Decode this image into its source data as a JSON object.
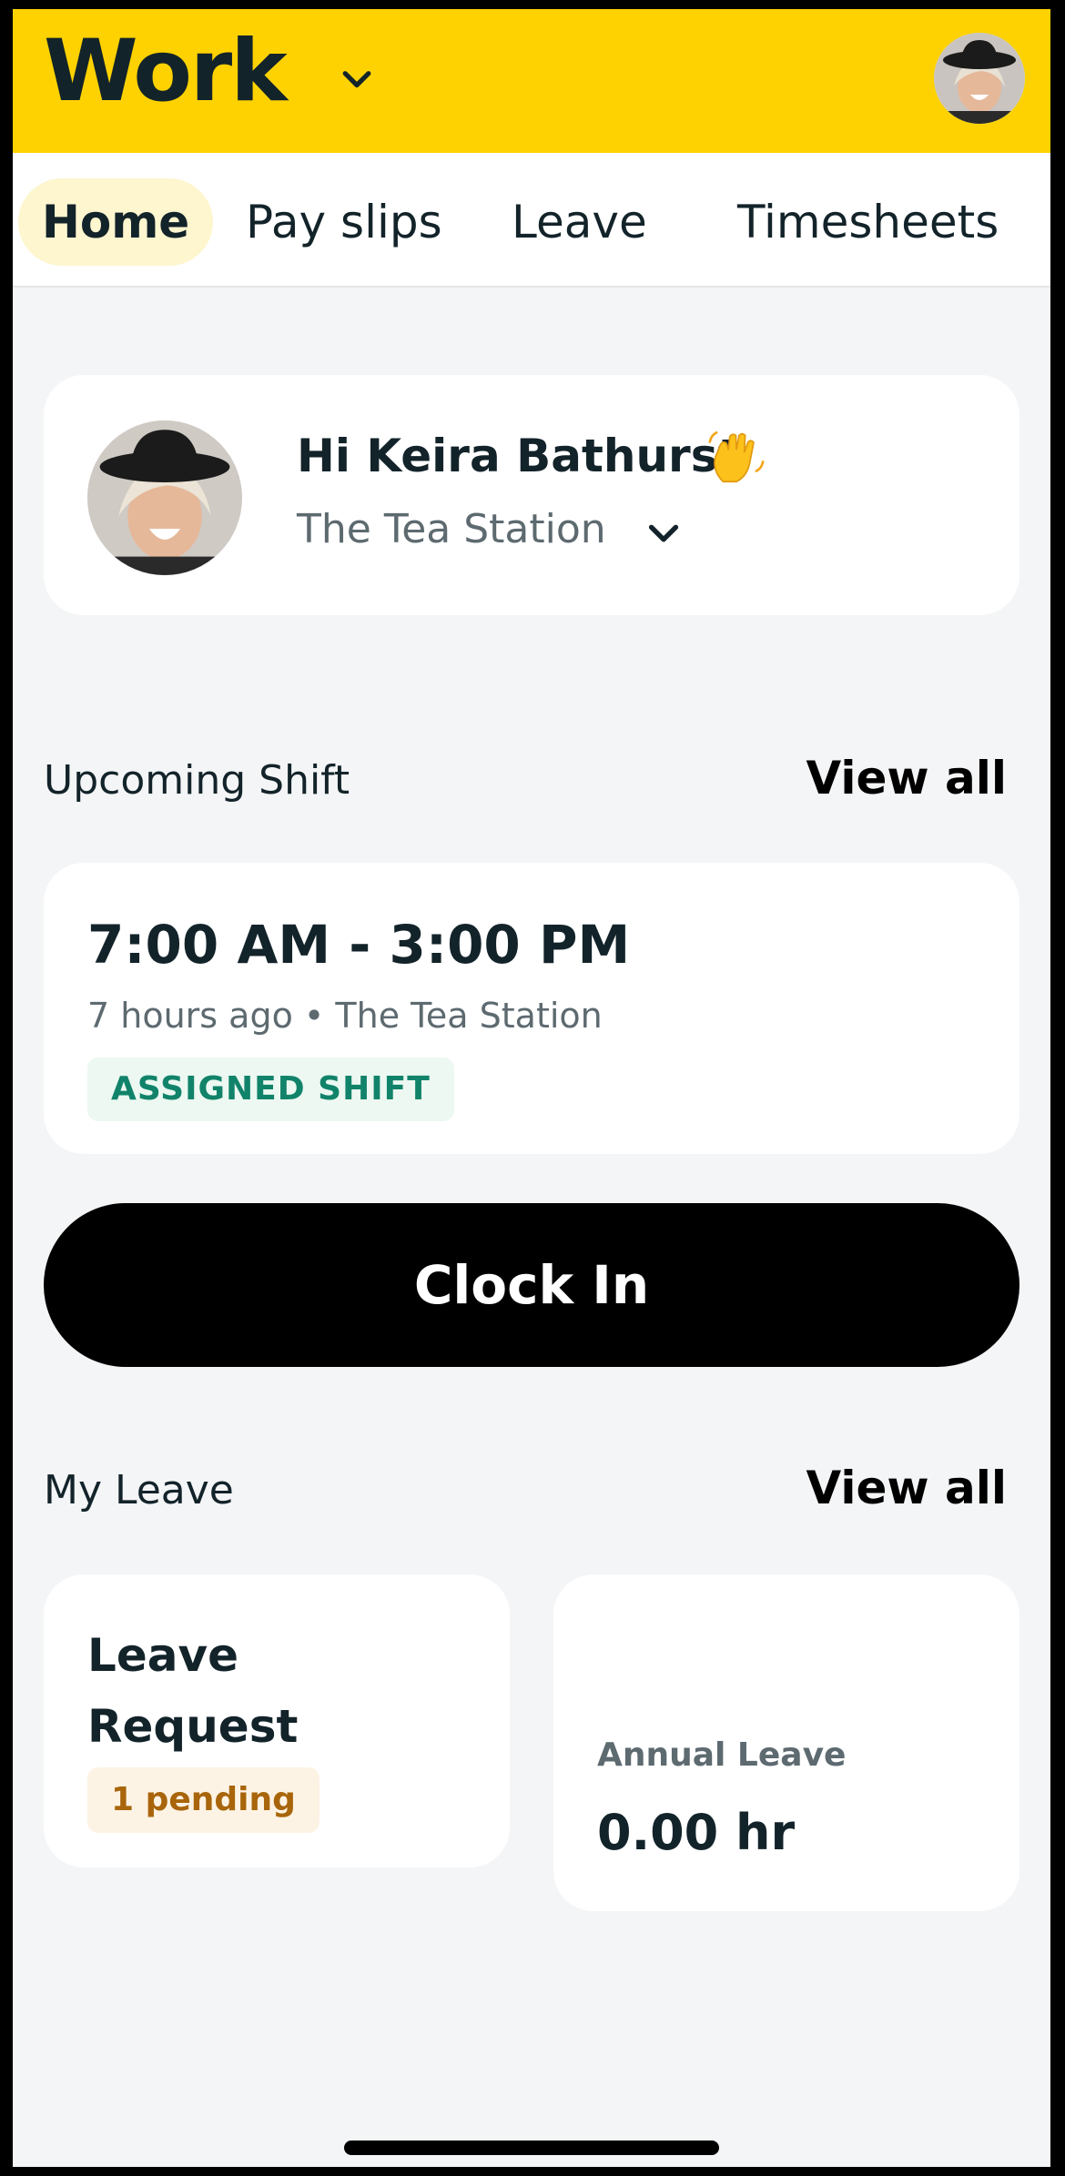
{
  "header": {
    "app_title": "Work"
  },
  "tabs": [
    {
      "label": "Home",
      "active": true
    },
    {
      "label": "Pay slips",
      "active": false
    },
    {
      "label": "Leave",
      "active": false
    },
    {
      "label": "Timesheets",
      "active": false
    }
  ],
  "greeting": {
    "text": "Hi Keira Bathurst",
    "emoji_icon": "waving-hand-icon",
    "venue": "The Tea Station"
  },
  "upcoming_shift": {
    "section_title": "Upcoming Shift",
    "view_all": "View all",
    "time_range": "7:00 AM - 3:00 PM",
    "meta": "7 hours ago • The Tea Station",
    "badge": "ASSIGNED SHIFT"
  },
  "clock_in": {
    "label": "Clock In"
  },
  "my_leave": {
    "section_title": "My Leave",
    "view_all": "View all",
    "request_title": "Leave Request",
    "pending_badge": "1 pending",
    "annual_label": "Annual Leave",
    "annual_value": "0.00 hr"
  },
  "colors": {
    "brand_yellow": "#fdd200",
    "text_dark": "#13232a",
    "assigned_green": "#11836a",
    "pending_orange": "#a8650b"
  }
}
